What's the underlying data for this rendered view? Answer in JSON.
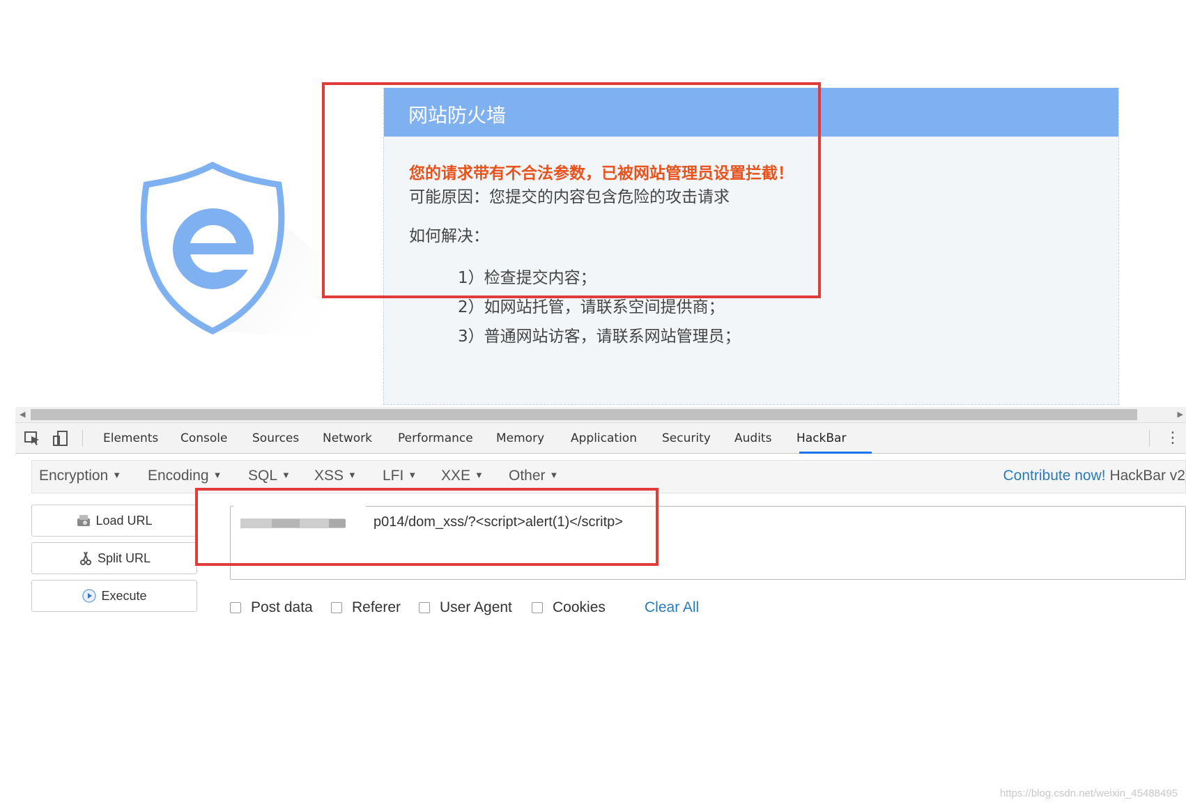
{
  "waf": {
    "title": "网站防火墙",
    "warning": "您的请求带有不合法参数，已被网站管理员设置拦截！",
    "reason": "可能原因：您提交的内容包含危险的攻击请求",
    "how": "如何解决：",
    "steps": [
      "1）检查提交内容；",
      "2）如网站托管，请联系空间提供商；",
      "3）普通网站访客，请联系网站管理员；"
    ]
  },
  "devtools": {
    "tabs": [
      "Elements",
      "Console",
      "Sources",
      "Network",
      "Performance",
      "Memory",
      "Application",
      "Security",
      "Audits",
      "HackBar"
    ],
    "active_tab": "HackBar"
  },
  "hackbar": {
    "menu": [
      "Encryption",
      "Encoding",
      "SQL",
      "XSS",
      "LFI",
      "XXE",
      "Other"
    ],
    "contribute_link": "Contribute now!",
    "version": "HackBar v2",
    "buttons": {
      "load": "Load URL",
      "split": "Split URL",
      "execute": "Execute"
    },
    "url_value": "p014/dom_xss/?<script>alert(1)</scritp>",
    "options": [
      "Post data",
      "Referer",
      "User Agent",
      "Cookies"
    ],
    "clear_all": "Clear All"
  },
  "watermark": "https://blog.csdn.net/weixin_45488495",
  "colors": {
    "header_blue": "#7fb1f1",
    "warning_orange": "#e8521c",
    "highlight_red": "#e03c3c",
    "link_blue": "#2a7ab8"
  }
}
